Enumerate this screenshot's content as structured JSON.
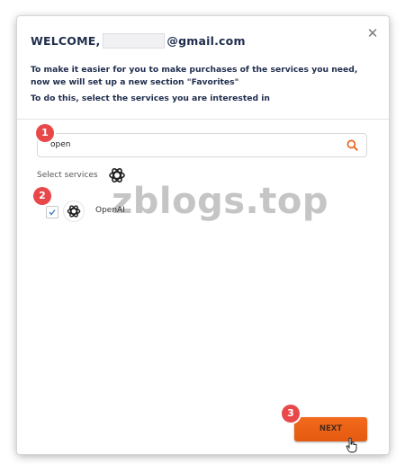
{
  "dialog": {
    "title_prefix": "WELCOME,",
    "title_suffix": "@gmail.com",
    "close_icon": "close-icon",
    "intro_line1": "To make it easier for you to make purchases of the services you need, now we will set up a new section \"Favorites\"",
    "intro_line2": "To do this, select the services you are interested in"
  },
  "search": {
    "value": "open",
    "icon": "search-icon"
  },
  "select_label": "Select services",
  "services": [
    {
      "label": "OpenAI",
      "checked": true,
      "icon": "openai-logo-icon"
    }
  ],
  "steps": [
    "1",
    "2",
    "3"
  ],
  "watermark": "zblogs.top",
  "next_label": "NEXT",
  "colors": {
    "accent": "#f26a1c",
    "badge": "#e8484a",
    "title": "#1f2d4d"
  }
}
